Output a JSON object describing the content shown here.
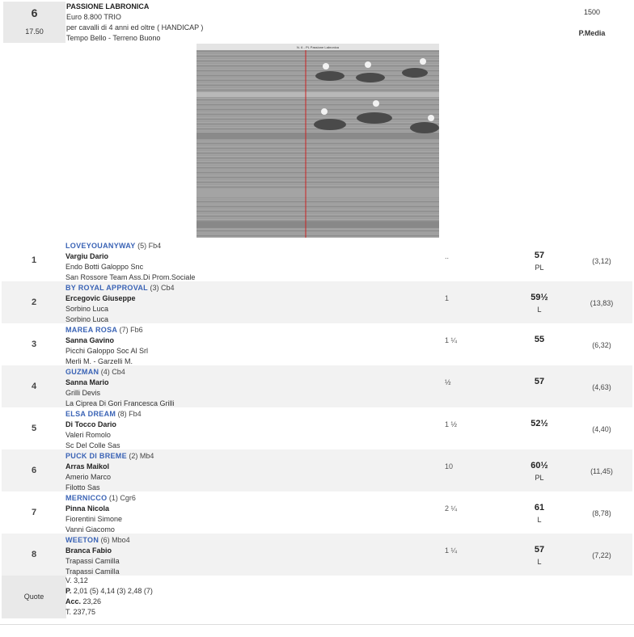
{
  "race": {
    "number": "6",
    "time": "17.50",
    "name": "PASSIONE LABRONICA",
    "prize": "Euro 8.800 TRIO",
    "conditions": "per cavalli di 4 anni ed oltre ( HANDICAP )",
    "weather": "Tempo Bello - Terreno Buono",
    "distance": "1500",
    "track": "P.Media",
    "photo_caption": "N. 6 - PL Passione Labronica"
  },
  "results": [
    {
      "pos": "1",
      "horse": "LOVEYOUANYWAY",
      "extra": " (5) Fb4",
      "jockey": "Vargiu Dario",
      "trainer": "Endo Botti Galoppo Snc",
      "owner": "San Rossore Team Ass.Di Prom.Sociale",
      "distance": "..",
      "weight": "57",
      "suffix": "PL",
      "odds": "(3,12)"
    },
    {
      "pos": "2",
      "horse": "BY ROYAL APPROVAL",
      "extra": " (3) Cb4",
      "jockey": "Ercegovic Giuseppe",
      "trainer": "Sorbino Luca",
      "owner": "Sorbino Luca",
      "distance": "1",
      "weight": "59½",
      "suffix": "L",
      "odds": "(13,83)"
    },
    {
      "pos": "3",
      "horse": "MAREA ROSA",
      "extra": " (7) Fb6",
      "jockey": "Sanna Gavino",
      "trainer": "Picchi Galoppo Soc Al Srl",
      "owner": "Merli M. - Garzelli M.",
      "distance": "1 ¼",
      "weight": "55",
      "suffix": "",
      "odds": "(6,32)"
    },
    {
      "pos": "4",
      "horse": "GUZMAN",
      "extra": " (4) Cb4",
      "jockey": "Sanna Mario",
      "trainer": "Grilli Devis",
      "owner": "La Ciprea Di Gori Francesca Grilli",
      "distance": "½",
      "weight": "57",
      "suffix": "",
      "odds": "(4,63)"
    },
    {
      "pos": "5",
      "horse": "ELSA DREAM",
      "extra": " (8) Fb4",
      "jockey": "Di Tocco Dario",
      "trainer": "Valeri Romolo",
      "owner": "Sc Del Colle Sas",
      "distance": "1 ½",
      "weight": "52½",
      "suffix": "",
      "odds": "(4,40)"
    },
    {
      "pos": "6",
      "horse": "PUCK DI BREME",
      "extra": " (2) Mb4",
      "jockey": "Arras Maikol",
      "trainer": "Amerio Marco",
      "owner": "Filotto Sas",
      "distance": "10",
      "weight": "60½",
      "suffix": "PL",
      "odds": "(11,45)"
    },
    {
      "pos": "7",
      "horse": "MERNICCO",
      "extra": " (1) Cgr6",
      "jockey": "Pinna Nicola",
      "trainer": "Fiorentini Simone",
      "owner": "Vanni Giacomo",
      "distance": "2 ¼",
      "weight": "61",
      "suffix": "L",
      "odds": "(8,78)"
    },
    {
      "pos": "8",
      "horse": "WEETON",
      "extra": " (6) Mbo4",
      "jockey": "Branca Fabio",
      "trainer": "Trapassi Camilla",
      "owner": "Trapassi Camilla",
      "distance": "1 ¼",
      "weight": "57",
      "suffix": "L",
      "odds": "(7,22)"
    }
  ],
  "quote": {
    "label": "Quote",
    "v": "V. 3,12",
    "p_label": "P.",
    "p_values": " 2,01 (5)  4,14 (3)  2,48 (7)",
    "acc_label": "Acc.",
    "acc_value": " 23,26",
    "t": "T. 237,75"
  }
}
